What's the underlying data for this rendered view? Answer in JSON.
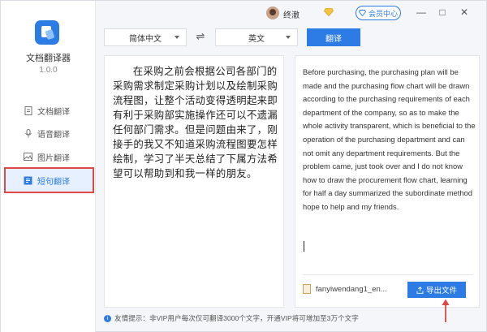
{
  "app": {
    "name": "文档翻译器",
    "version": "1.0.0"
  },
  "sidebar": {
    "items": [
      {
        "label": "文档翻译",
        "icon": "document-icon"
      },
      {
        "label": "语音翻译",
        "icon": "microphone-icon"
      },
      {
        "label": "图片翻译",
        "icon": "image-icon"
      },
      {
        "label": "短句翻译",
        "icon": "phrase-icon"
      }
    ],
    "active_index": 3
  },
  "titlebar": {
    "user_name": "终澈",
    "member_label": "会员中心",
    "minimize": "—",
    "maximize": "□",
    "close": "✕"
  },
  "toolbar": {
    "source_lang": "简体中文",
    "target_lang": "英文",
    "swap_glyph": "⇌",
    "translate_label": "翻译"
  },
  "source": {
    "text": "在采购之前会根据公司各部门的采购需求制定采购计划以及绘制采购流程图，让整个活动变得透明起来即有利于采购部实施操作还可以不遗漏任何部门需求。但是问题由来了，刚接手的我又不知道采购流程图要怎样绘制，学习了半天总结了下属方法希望可以帮助到和我一样的朋友。"
  },
  "result": {
    "text": "Before purchasing, the purchasing plan will be made and the purchasing flow chart will be drawn according to the purchasing requirements of each department of the company, so as to make the whole activity transparent, which is beneficial to the operation of the purchasing department and can not omit any department requirements. But the problem came, just took over and I do not know how to draw the procurement flow chart, learning for half a day summarized the subordinate method hope to help and my friends.",
    "file_name": "fanyiwendang1_en...",
    "export_label": "导出文件"
  },
  "footer": {
    "tip": "友情提示：非VIP用户每次仅可翻译3000个文字，开通VIP将可增加至3万个文字"
  },
  "colors": {
    "accent": "#2d7be5",
    "highlight": "#e04848"
  }
}
